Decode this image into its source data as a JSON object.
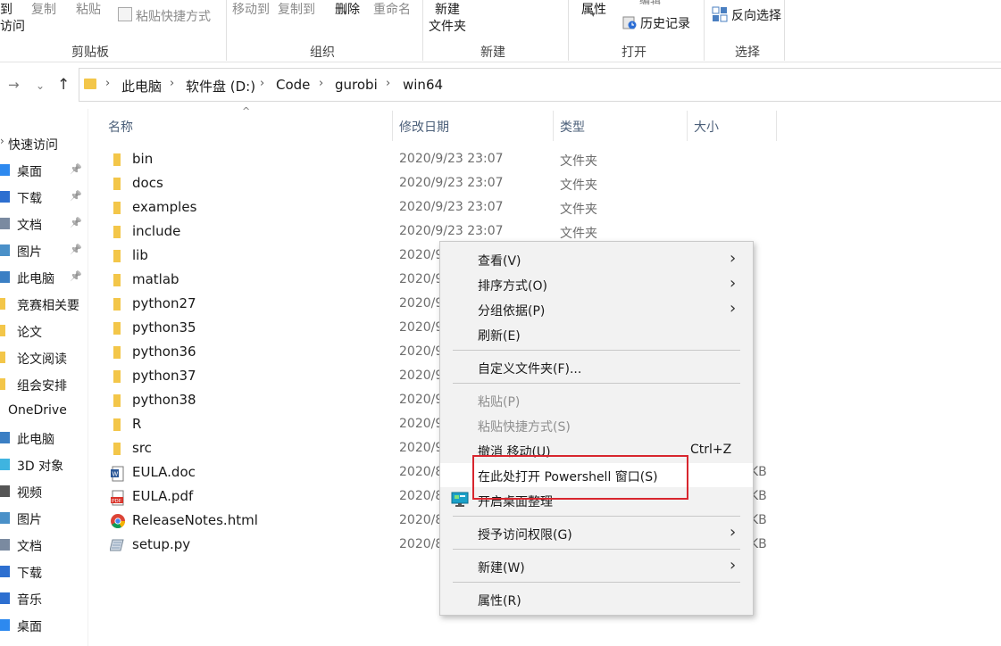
{
  "ribbon": {
    "clipboard": {
      "partial_line1": "到",
      "partial_line2": "访问",
      "copy": "复制",
      "paste": "粘贴",
      "paste_shortcut": "粘贴快捷方式",
      "label": "剪贴板"
    },
    "organize": {
      "move_to": "移动到",
      "copy_to": "复制到",
      "delete": "删除",
      "rename": "重命名",
      "label": "组织"
    },
    "new": {
      "new_folder_line1": "新建",
      "new_folder_line2": "文件夹",
      "label": "新建"
    },
    "open": {
      "properties": "属性",
      "edit_partial": "编辑",
      "history": "历史记录",
      "label": "打开"
    },
    "select": {
      "invert": "反向选择",
      "label": "选择"
    }
  },
  "address": {
    "crumbs": [
      "此电脑",
      "软件盘 (D:)",
      "Code",
      "gurobi",
      "win64"
    ]
  },
  "leftnav": {
    "items": [
      {
        "label": "快速访问",
        "icon": "star-icon"
      },
      {
        "label": "桌面",
        "icon": "desktop-icon",
        "pinned": true
      },
      {
        "label": "下载",
        "icon": "download-icon",
        "pinned": true
      },
      {
        "label": "文档",
        "icon": "document-icon",
        "pinned": true
      },
      {
        "label": "图片",
        "icon": "picture-icon",
        "pinned": true
      },
      {
        "label": "此电脑",
        "icon": "computer-icon",
        "pinned": true
      },
      {
        "label": "竞赛相关要",
        "icon": "folder-icon"
      },
      {
        "label": "论文",
        "icon": "folder-icon"
      },
      {
        "label": "论文阅读",
        "icon": "folder-icon"
      },
      {
        "label": "组会安排",
        "icon": "folder-icon"
      },
      {
        "label": "OneDrive",
        "icon": "cloud-icon"
      },
      {
        "label": "此电脑",
        "icon": "computer-icon"
      },
      {
        "label": "3D 对象",
        "icon": "cube-icon"
      },
      {
        "label": "视频",
        "icon": "video-icon"
      },
      {
        "label": "图片",
        "icon": "picture-icon"
      },
      {
        "label": "文档",
        "icon": "document-icon"
      },
      {
        "label": "下载",
        "icon": "download-icon"
      },
      {
        "label": "音乐",
        "icon": "music-icon"
      },
      {
        "label": "桌面",
        "icon": "desktop-icon"
      }
    ],
    "pin_glyph": "📌"
  },
  "columns": {
    "name": "名称",
    "date": "修改日期",
    "type": "类型",
    "size": "大小"
  },
  "files": [
    {
      "name": "bin",
      "date": "2020/9/23 23:07",
      "type": "文件夹",
      "size": "",
      "icon": "folder-icon"
    },
    {
      "name": "docs",
      "date": "2020/9/23 23:07",
      "type": "文件夹",
      "size": "",
      "icon": "folder-icon"
    },
    {
      "name": "examples",
      "date": "2020/9/23 23:07",
      "type": "文件夹",
      "size": "",
      "icon": "folder-icon"
    },
    {
      "name": "include",
      "date": "2020/9/23 23:07",
      "type": "文件夹",
      "size": "",
      "icon": "folder-icon"
    },
    {
      "name": "lib",
      "date": "2020/9",
      "type": "",
      "size": "",
      "icon": "folder-icon"
    },
    {
      "name": "matlab",
      "date": "2020/9",
      "type": "",
      "size": "",
      "icon": "folder-icon"
    },
    {
      "name": "python27",
      "date": "2020/9",
      "type": "",
      "size": "",
      "icon": "folder-icon"
    },
    {
      "name": "python35",
      "date": "2020/9",
      "type": "",
      "size": "",
      "icon": "folder-icon"
    },
    {
      "name": "python36",
      "date": "2020/9",
      "type": "",
      "size": "",
      "icon": "folder-icon"
    },
    {
      "name": "python37",
      "date": "2020/9",
      "type": "",
      "size": "",
      "icon": "folder-icon"
    },
    {
      "name": "python38",
      "date": "2020/9",
      "type": "",
      "size": "",
      "icon": "folder-icon"
    },
    {
      "name": "R",
      "date": "2020/9",
      "type": "",
      "size": "",
      "icon": "folder-icon"
    },
    {
      "name": "src",
      "date": "2020/9",
      "type": "",
      "size": "",
      "icon": "folder-icon"
    },
    {
      "name": "EULA.doc",
      "date": "2020/8",
      "type": "",
      "size": "KB",
      "icon": "word-doc-icon"
    },
    {
      "name": "EULA.pdf",
      "date": "2020/8",
      "type": "",
      "size": "KB",
      "icon": "pdf-icon"
    },
    {
      "name": "ReleaseNotes.html",
      "date": "2020/8",
      "type": "",
      "size": "KB",
      "icon": "chrome-icon"
    },
    {
      "name": "setup.py",
      "date": "2020/8",
      "type": "",
      "size": "KB",
      "icon": "python-file-icon"
    }
  ],
  "context_menu": {
    "view": "查看(V)",
    "sort_by": "排序方式(O)",
    "group_by": "分组依据(P)",
    "refresh": "刷新(E)",
    "customize_folder": "自定义文件夹(F)...",
    "paste": "粘贴(P)",
    "paste_shortcut": "粘贴快捷方式(S)",
    "undo_move": "撤消 移动(U)",
    "undo_shortcut": "Ctrl+Z",
    "open_powershell": "在此处打开 Powershell 窗口(S)",
    "desktop_organize": "开启桌面整理",
    "give_access": "授予访问权限(G)",
    "new": "新建(W)",
    "properties": "属性(R)",
    "chevron": "›"
  },
  "colors": {
    "folder": "#f3c649",
    "highlight_box": "#d8262e",
    "header_text": "#4c607a",
    "menu_bg": "#f2f2f2"
  }
}
